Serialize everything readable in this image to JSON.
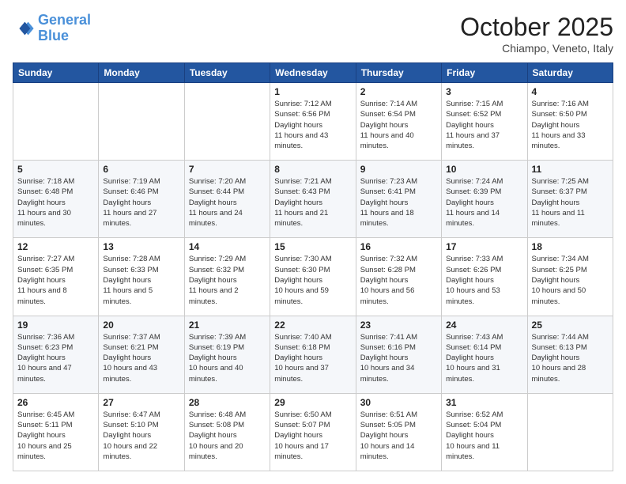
{
  "header": {
    "logo_line1": "General",
    "logo_line2": "Blue",
    "month": "October 2025",
    "location": "Chiampo, Veneto, Italy"
  },
  "days_of_week": [
    "Sunday",
    "Monday",
    "Tuesday",
    "Wednesday",
    "Thursday",
    "Friday",
    "Saturday"
  ],
  "weeks": [
    [
      null,
      null,
      null,
      {
        "day": "1",
        "sunrise": "7:12 AM",
        "sunset": "6:56 PM",
        "daylight": "11 hours and 43 minutes."
      },
      {
        "day": "2",
        "sunrise": "7:14 AM",
        "sunset": "6:54 PM",
        "daylight": "11 hours and 40 minutes."
      },
      {
        "day": "3",
        "sunrise": "7:15 AM",
        "sunset": "6:52 PM",
        "daylight": "11 hours and 37 minutes."
      },
      {
        "day": "4",
        "sunrise": "7:16 AM",
        "sunset": "6:50 PM",
        "daylight": "11 hours and 33 minutes."
      }
    ],
    [
      {
        "day": "5",
        "sunrise": "7:18 AM",
        "sunset": "6:48 PM",
        "daylight": "11 hours and 30 minutes."
      },
      {
        "day": "6",
        "sunrise": "7:19 AM",
        "sunset": "6:46 PM",
        "daylight": "11 hours and 27 minutes."
      },
      {
        "day": "7",
        "sunrise": "7:20 AM",
        "sunset": "6:44 PM",
        "daylight": "11 hours and 24 minutes."
      },
      {
        "day": "8",
        "sunrise": "7:21 AM",
        "sunset": "6:43 PM",
        "daylight": "11 hours and 21 minutes."
      },
      {
        "day": "9",
        "sunrise": "7:23 AM",
        "sunset": "6:41 PM",
        "daylight": "11 hours and 18 minutes."
      },
      {
        "day": "10",
        "sunrise": "7:24 AM",
        "sunset": "6:39 PM",
        "daylight": "11 hours and 14 minutes."
      },
      {
        "day": "11",
        "sunrise": "7:25 AM",
        "sunset": "6:37 PM",
        "daylight": "11 hours and 11 minutes."
      }
    ],
    [
      {
        "day": "12",
        "sunrise": "7:27 AM",
        "sunset": "6:35 PM",
        "daylight": "11 hours and 8 minutes."
      },
      {
        "day": "13",
        "sunrise": "7:28 AM",
        "sunset": "6:33 PM",
        "daylight": "11 hours and 5 minutes."
      },
      {
        "day": "14",
        "sunrise": "7:29 AM",
        "sunset": "6:32 PM",
        "daylight": "11 hours and 2 minutes."
      },
      {
        "day": "15",
        "sunrise": "7:30 AM",
        "sunset": "6:30 PM",
        "daylight": "10 hours and 59 minutes."
      },
      {
        "day": "16",
        "sunrise": "7:32 AM",
        "sunset": "6:28 PM",
        "daylight": "10 hours and 56 minutes."
      },
      {
        "day": "17",
        "sunrise": "7:33 AM",
        "sunset": "6:26 PM",
        "daylight": "10 hours and 53 minutes."
      },
      {
        "day": "18",
        "sunrise": "7:34 AM",
        "sunset": "6:25 PM",
        "daylight": "10 hours and 50 minutes."
      }
    ],
    [
      {
        "day": "19",
        "sunrise": "7:36 AM",
        "sunset": "6:23 PM",
        "daylight": "10 hours and 47 minutes."
      },
      {
        "day": "20",
        "sunrise": "7:37 AM",
        "sunset": "6:21 PM",
        "daylight": "10 hours and 43 minutes."
      },
      {
        "day": "21",
        "sunrise": "7:39 AM",
        "sunset": "6:19 PM",
        "daylight": "10 hours and 40 minutes."
      },
      {
        "day": "22",
        "sunrise": "7:40 AM",
        "sunset": "6:18 PM",
        "daylight": "10 hours and 37 minutes."
      },
      {
        "day": "23",
        "sunrise": "7:41 AM",
        "sunset": "6:16 PM",
        "daylight": "10 hours and 34 minutes."
      },
      {
        "day": "24",
        "sunrise": "7:43 AM",
        "sunset": "6:14 PM",
        "daylight": "10 hours and 31 minutes."
      },
      {
        "day": "25",
        "sunrise": "7:44 AM",
        "sunset": "6:13 PM",
        "daylight": "10 hours and 28 minutes."
      }
    ],
    [
      {
        "day": "26",
        "sunrise": "6:45 AM",
        "sunset": "5:11 PM",
        "daylight": "10 hours and 25 minutes."
      },
      {
        "day": "27",
        "sunrise": "6:47 AM",
        "sunset": "5:10 PM",
        "daylight": "10 hours and 22 minutes."
      },
      {
        "day": "28",
        "sunrise": "6:48 AM",
        "sunset": "5:08 PM",
        "daylight": "10 hours and 20 minutes."
      },
      {
        "day": "29",
        "sunrise": "6:50 AM",
        "sunset": "5:07 PM",
        "daylight": "10 hours and 17 minutes."
      },
      {
        "day": "30",
        "sunrise": "6:51 AM",
        "sunset": "5:05 PM",
        "daylight": "10 hours and 14 minutes."
      },
      {
        "day": "31",
        "sunrise": "6:52 AM",
        "sunset": "5:04 PM",
        "daylight": "10 hours and 11 minutes."
      },
      null
    ]
  ]
}
